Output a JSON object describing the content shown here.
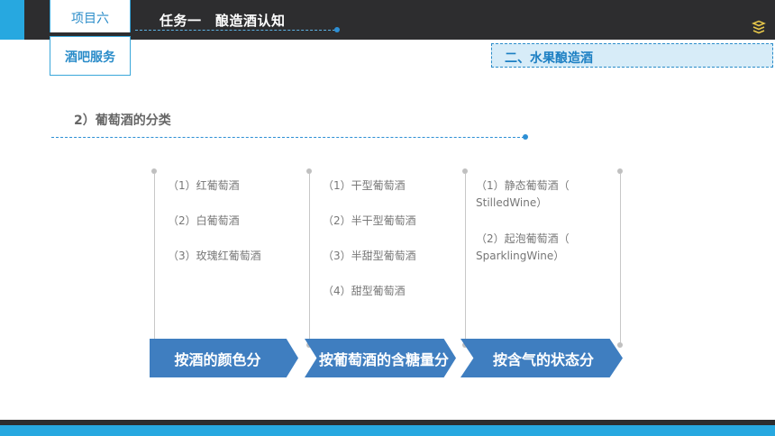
{
  "header": {
    "project_label": "项目六",
    "course_label": "酒吧服务",
    "task_title": "任务一　酿造酒认知",
    "section_label": "二、水果酿造酒"
  },
  "subtitle": "2）葡萄酒的分类",
  "columns": [
    {
      "items": [
        "（1）红葡萄酒",
        "（2）白葡萄酒",
        "（3）玫瑰红葡萄酒"
      ],
      "category": "按酒的颜色分"
    },
    {
      "items": [
        "（1）干型葡萄酒",
        "（2）半干型葡萄酒",
        "（3）半甜型葡萄酒",
        "（4）甜型葡萄酒"
      ],
      "category": "按葡萄酒的含糖量分"
    },
    {
      "items": [
        "（1）静态葡萄酒（",
        "StilledWine）",
        "（2）起泡葡萄酒（",
        "SparklingWine）"
      ],
      "category": "按含气的状态分"
    }
  ],
  "colors": {
    "accent_blue": "#27a8e0",
    "dark_bar": "#2d2d2f",
    "arrow_fill": "#3f7ec0",
    "section_fill": "#d7ecf8"
  },
  "icons": {
    "logo": "stacked-books-icon"
  }
}
